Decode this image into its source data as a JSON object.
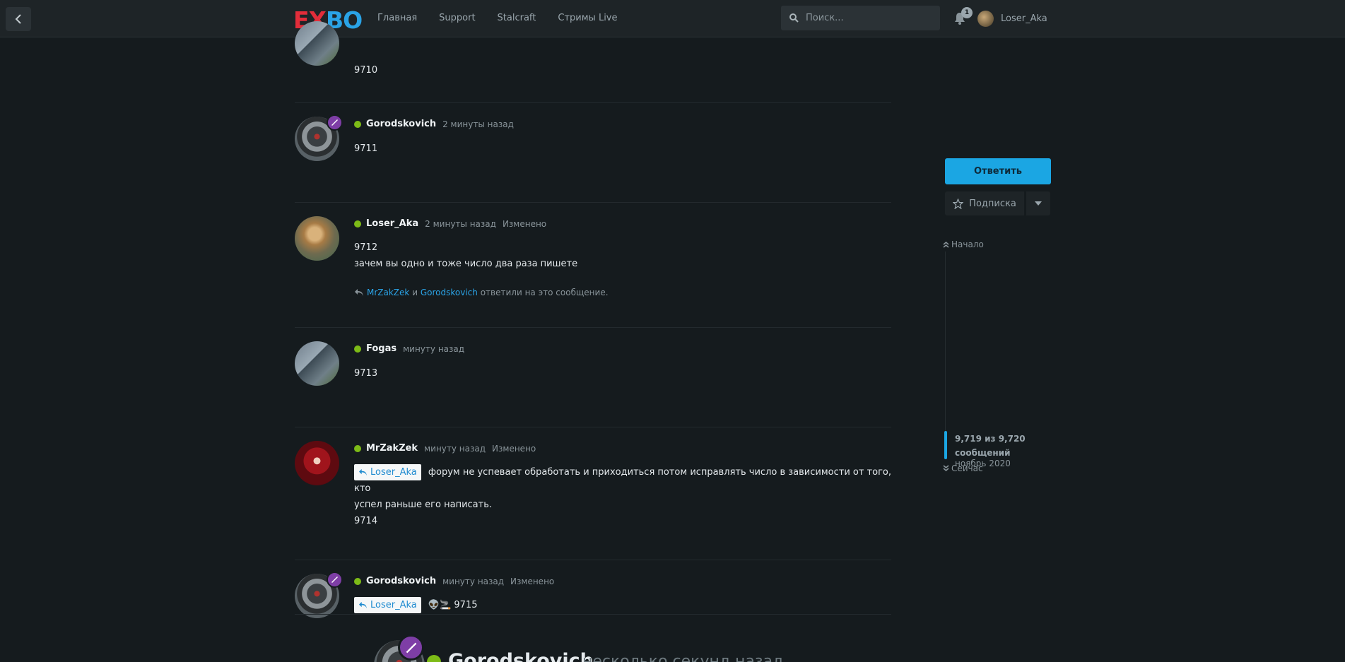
{
  "header": {
    "logo": {
      "e": "E",
      "x": "X",
      "bo": "BO"
    },
    "nav": [
      "Главная",
      "Support",
      "Stalcraft",
      "Стримы Live"
    ],
    "search_placeholder": "Поиск...",
    "notifications_count": "1",
    "username": "Loser_Aka"
  },
  "posts": [
    {
      "text": "9710"
    },
    {
      "user": "Gorodskovich",
      "time": "2 минуты назад",
      "text": "9711"
    },
    {
      "user": "Loser_Aka",
      "time": "2 минуты назад",
      "edited": "Изменено",
      "lines": [
        "9712",
        "зачем вы одно и тоже число два раза пишете"
      ],
      "replies": {
        "user1": "MrZakZek",
        "and": "и",
        "user2": "Gorodskovich",
        "tail": "ответили на это сообщение."
      }
    },
    {
      "user": "Fogas",
      "time": "минуту назад",
      "text": "9713"
    },
    {
      "user": "MrZakZek",
      "time": "минуту назад",
      "edited": "Изменено",
      "mention": "Loser_Aka",
      "line1": "форум не успевает обработать и приходиться потом исправлять число в зависимости от того, кто",
      "line2": "успел раньше его написать.",
      "line3": "9714"
    },
    {
      "user": "Gorodskovich",
      "time": "минуту назад",
      "edited": "Изменено",
      "mention": "Loser_Aka",
      "emoji": "👽🚬",
      "text": "9715"
    }
  ],
  "preview": {
    "user": "Gorodskovich",
    "time": "несколько секунд назад"
  },
  "sidebar": {
    "reply": "Ответить",
    "subscribe": "Подписка",
    "top": "Начало",
    "count_line1": "9,719 из 9,720",
    "count_line2": "сообщений",
    "date": "ноябрь 2020",
    "now": "Сейчас"
  },
  "colors": {
    "accent": "#1ba6e3",
    "online": "#7dbb17",
    "moderator": "#7e3ea6",
    "logo_red": "#e22d3a",
    "logo_blue": "#2aa3e6"
  }
}
